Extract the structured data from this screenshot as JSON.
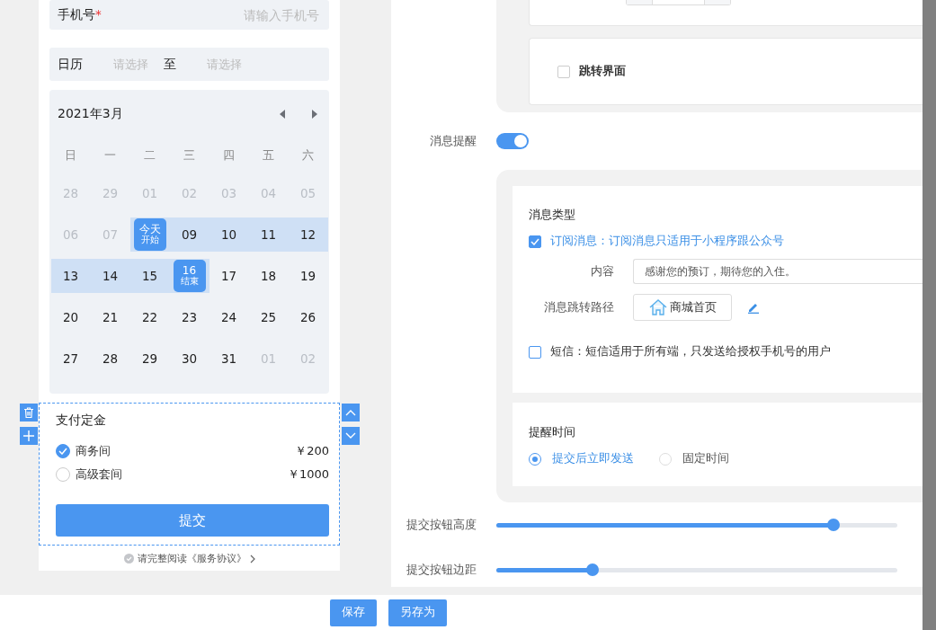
{
  "phone": {
    "phone_field": {
      "label": "手机号",
      "required_mark": "*",
      "placeholder": "请输入手机号"
    },
    "date_range": {
      "label": "日历",
      "start_placeholder": "请选择",
      "separator": "至",
      "end_placeholder": "请选择"
    },
    "calendar": {
      "title": "2021年3月",
      "weekdays": [
        "日",
        "一",
        "二",
        "三",
        "四",
        "五",
        "六"
      ],
      "weeks": [
        [
          {
            "day": "28",
            "muted": true,
            "in_range": false,
            "endpoint": false
          },
          {
            "day": "29",
            "muted": true,
            "in_range": false,
            "endpoint": false
          },
          {
            "day": "01",
            "muted": true,
            "in_range": false,
            "endpoint": false
          },
          {
            "day": "02",
            "muted": true,
            "in_range": false,
            "endpoint": false
          },
          {
            "day": "03",
            "muted": true,
            "in_range": false,
            "endpoint": false
          },
          {
            "day": "04",
            "muted": true,
            "in_range": false,
            "endpoint": false
          },
          {
            "day": "05",
            "muted": true,
            "in_range": false,
            "endpoint": false
          }
        ],
        [
          {
            "day": "06",
            "muted": true,
            "in_range": false,
            "endpoint": false
          },
          {
            "day": "07",
            "muted": true,
            "in_range": false,
            "endpoint": false
          },
          {
            "day": "今天",
            "sub": "开始",
            "muted": false,
            "in_range": true,
            "endpoint": true
          },
          {
            "day": "09",
            "muted": false,
            "in_range": true,
            "endpoint": false
          },
          {
            "day": "10",
            "muted": false,
            "in_range": true,
            "endpoint": false
          },
          {
            "day": "11",
            "muted": false,
            "in_range": true,
            "endpoint": false
          },
          {
            "day": "12",
            "muted": false,
            "in_range": true,
            "endpoint": false
          }
        ],
        [
          {
            "day": "13",
            "muted": false,
            "in_range": true,
            "endpoint": false
          },
          {
            "day": "14",
            "muted": false,
            "in_range": true,
            "endpoint": false
          },
          {
            "day": "15",
            "muted": false,
            "in_range": true,
            "endpoint": false
          },
          {
            "day": "16",
            "sub": "结束",
            "muted": false,
            "in_range": true,
            "endpoint": true
          },
          {
            "day": "17",
            "muted": false,
            "in_range": false,
            "endpoint": false
          },
          {
            "day": "18",
            "muted": false,
            "in_range": false,
            "endpoint": false
          },
          {
            "day": "19",
            "muted": false,
            "in_range": false,
            "endpoint": false
          }
        ],
        [
          {
            "day": "20",
            "muted": false,
            "in_range": false,
            "endpoint": false
          },
          {
            "day": "21",
            "muted": false,
            "in_range": false,
            "endpoint": false
          },
          {
            "day": "22",
            "muted": false,
            "in_range": false,
            "endpoint": false
          },
          {
            "day": "23",
            "muted": false,
            "in_range": false,
            "endpoint": false
          },
          {
            "day": "24",
            "muted": false,
            "in_range": false,
            "endpoint": false
          },
          {
            "day": "25",
            "muted": false,
            "in_range": false,
            "endpoint": false
          },
          {
            "day": "26",
            "muted": false,
            "in_range": false,
            "endpoint": false
          }
        ],
        [
          {
            "day": "27",
            "muted": false,
            "in_range": false,
            "endpoint": false
          },
          {
            "day": "28",
            "muted": false,
            "in_range": false,
            "endpoint": false
          },
          {
            "day": "29",
            "muted": false,
            "in_range": false,
            "endpoint": false
          },
          {
            "day": "30",
            "muted": false,
            "in_range": false,
            "endpoint": false
          },
          {
            "day": "31",
            "muted": false,
            "in_range": false,
            "endpoint": false
          },
          {
            "day": "01",
            "muted": true,
            "in_range": false,
            "endpoint": false
          },
          {
            "day": "02",
            "muted": true,
            "in_range": false,
            "endpoint": false
          }
        ]
      ]
    },
    "payment": {
      "title": "支付定金",
      "options": [
        {
          "label": "商务间",
          "price": "￥200",
          "selected": true
        },
        {
          "label": "高级套间",
          "price": "￥1000",
          "selected": false
        }
      ],
      "submit": "提交"
    },
    "agreement": "请完整阅读《服务协议》"
  },
  "settings": {
    "jump_page": {
      "label": "跳转界面",
      "checked": false
    },
    "message_reminder": {
      "label": "消息提醒",
      "on": true
    },
    "message_type": {
      "title": "消息类型",
      "subscribe": {
        "label": "订阅消息：订阅消息只适用于小程序跟公众号",
        "checked": true
      },
      "content_label": "内容",
      "content_value": "感谢您的预订，期待您的入住。",
      "path_label": "消息跳转路径",
      "path_value": "商城首页",
      "sms": {
        "label": "短信：短信适用于所有端，只发送给授权手机号的用户",
        "checked": false
      }
    },
    "reminder_time": {
      "title": "提醒时间",
      "options": [
        {
          "label": "提交后立即发送",
          "selected": true
        },
        {
          "label": "固定时间",
          "selected": false
        }
      ]
    },
    "sliders": [
      {
        "label": "提交按钮高度",
        "level": 0.84
      },
      {
        "label": "提交按钮边距",
        "level": 0.24
      }
    ]
  },
  "footer": {
    "buttons": [
      "保存",
      "另存为"
    ]
  }
}
